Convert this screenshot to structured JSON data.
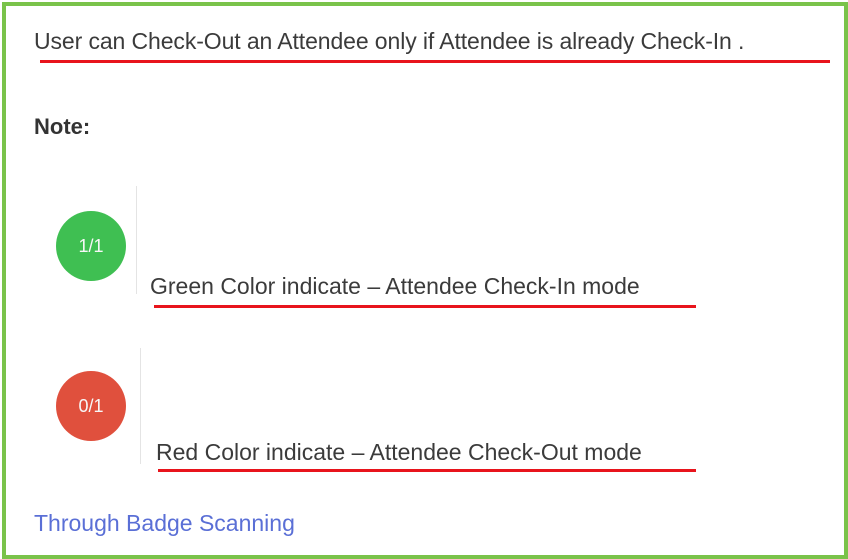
{
  "intro_text": "User can Check-Out an Attendee only if Attendee is already Check-In .",
  "note_label": "Note:",
  "items": [
    {
      "badge_text": "1/1",
      "description": "Green Color indicate – Attendee Check-In mode",
      "color": "#3fbf52"
    },
    {
      "badge_text": "0/1",
      "description": "Red Color indicate – Attendee Check-Out mode",
      "color": "#e0503d"
    }
  ],
  "link_text": "Through Badge Scanning",
  "colors": {
    "frame_border": "#7ac34a",
    "underline": "#e8141c",
    "link": "#5a6fd6"
  }
}
